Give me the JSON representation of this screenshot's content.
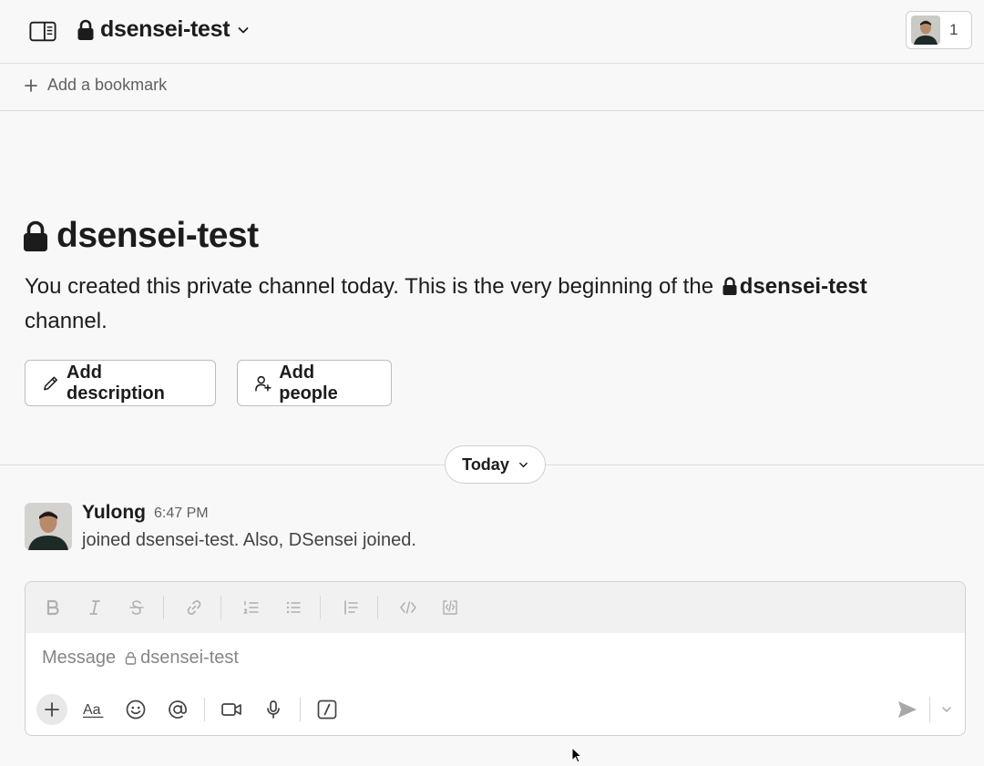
{
  "header": {
    "channel_name": "dsensei-test",
    "member_count": "1"
  },
  "bookmarks": {
    "add_label": "Add a bookmark"
  },
  "intro": {
    "title": "dsensei-test",
    "text_before": "You created this private channel today. This is the very beginning of the",
    "channel_ref": "dsensei-test",
    "text_after": "channel.",
    "add_description_label": "Add description",
    "add_people_label": "Add people"
  },
  "divider": {
    "date_label": "Today"
  },
  "messages": [
    {
      "author": "Yulong",
      "time": "6:47 PM",
      "body": "joined dsensei-test. Also, DSensei joined."
    }
  ],
  "composer": {
    "placeholder_prefix": "Message",
    "placeholder_channel": "dsensei-test"
  },
  "icons": {
    "sidebar_toggle": "sidebar-panel-icon",
    "lock": "lock-icon",
    "chevron": "chevron-down-icon",
    "plus": "plus-icon",
    "pencil": "pencil-icon",
    "add_user": "add-user-icon",
    "bold": "bold-icon",
    "italic": "italic-icon",
    "strike": "strikethrough-icon",
    "link": "link-icon",
    "ordered_list": "ordered-list-icon",
    "bullet_list": "bullet-list-icon",
    "blockquote": "blockquote-icon",
    "code": "code-icon",
    "code_block": "code-block-icon",
    "formatting": "text-format-icon",
    "emoji": "emoji-icon",
    "mention": "mention-icon",
    "video": "video-icon",
    "mic": "microphone-icon",
    "slash": "slash-command-icon",
    "send": "send-icon"
  },
  "colors": {
    "background": "#f8f8f8",
    "text": "#1d1c1d",
    "muted": "#616061",
    "border": "#dcdcdc"
  }
}
